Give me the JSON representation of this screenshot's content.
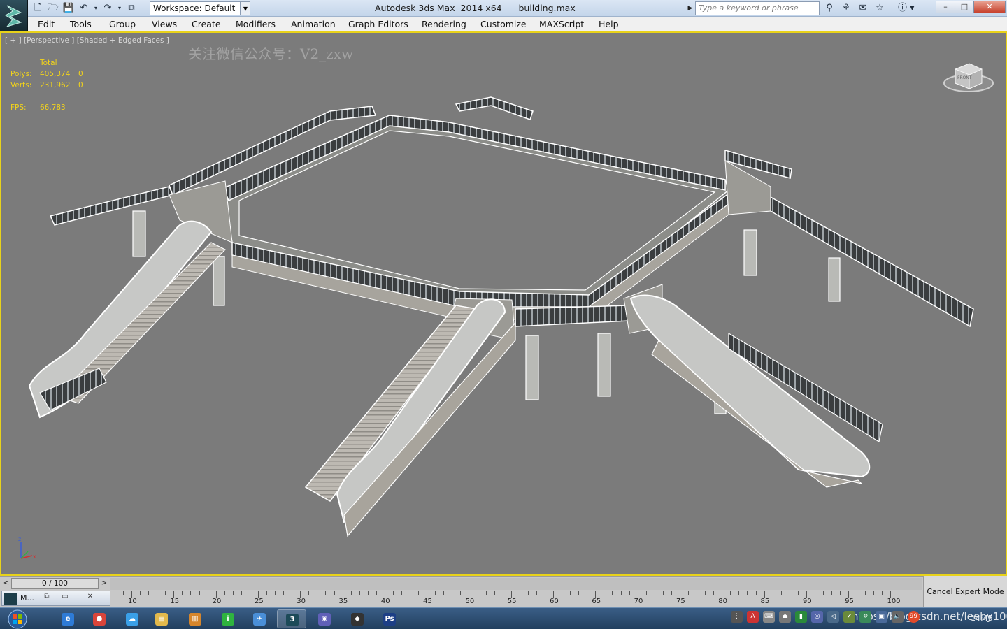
{
  "titlebar": {
    "workspace_label": "Workspace: Default",
    "app_title": "Autodesk 3ds Max  2014 x64",
    "file_name": "building.max",
    "search_placeholder": "Type a keyword or phrase",
    "window_buttons": {
      "minimize": "–",
      "maximize": "□",
      "close": "✕"
    }
  },
  "menu": {
    "items": [
      "Edit",
      "Tools",
      "Group",
      "Views",
      "Create",
      "Modifiers",
      "Animation",
      "Graph Editors",
      "Rendering",
      "Customize",
      "MAXScript",
      "Help"
    ]
  },
  "viewport": {
    "label_plus": "[ + ]",
    "label_view": "[Perspective ]",
    "label_shading": "[Shaded + Edged Faces ]",
    "watermark": "关注微信公众号：V2_zxw",
    "stats": {
      "header": "Total",
      "polys_label": "Polys:",
      "polys_value": "405,374",
      "polys_sel": "0",
      "verts_label": "Verts:",
      "verts_value": "231,962",
      "verts_sel": "0",
      "fps_label": "FPS:",
      "fps_value": "66.783"
    },
    "viewcube_label": "FRONT"
  },
  "timeline": {
    "frame_display": "0 / 100",
    "prev_arrow": "<",
    "next_arrow": ">",
    "ruler_numbers": [
      "10",
      "15",
      "20",
      "25",
      "30",
      "35",
      "40",
      "45",
      "50",
      "55",
      "60",
      "65",
      "70",
      "75",
      "80",
      "85",
      "90",
      "95",
      "100"
    ]
  },
  "bottom": {
    "mini_window_label": "M...",
    "cancel_expert": "Cancel Expert Mode"
  },
  "taskbar": {
    "apps": [
      {
        "name": "ie",
        "glyph": "e",
        "color": "#2e7bd6"
      },
      {
        "name": "chrome",
        "glyph": "●",
        "color": "#d9453b"
      },
      {
        "name": "baidu",
        "glyph": "☁",
        "color": "#3aa0e8"
      },
      {
        "name": "explorer",
        "glyph": "▤",
        "color": "#e2b94c"
      },
      {
        "name": "chart-app",
        "glyph": "▥",
        "color": "#d6862c"
      },
      {
        "name": "iqiyi",
        "glyph": "i",
        "color": "#2fb43f"
      },
      {
        "name": "bird",
        "glyph": "✈",
        "color": "#4a8fd8"
      },
      {
        "name": "3dsmax",
        "glyph": "3",
        "color": "#1c4a58"
      },
      {
        "name": "media",
        "glyph": "◉",
        "color": "#6060b8"
      },
      {
        "name": "unity",
        "glyph": "◆",
        "color": "#333"
      },
      {
        "name": "photoshop",
        "glyph": "Ps",
        "color": "#1d3f86"
      }
    ],
    "url_watermark": "https://blog.csdn.net/leeby100",
    "clock": "14:45",
    "notification_badge": "99"
  }
}
